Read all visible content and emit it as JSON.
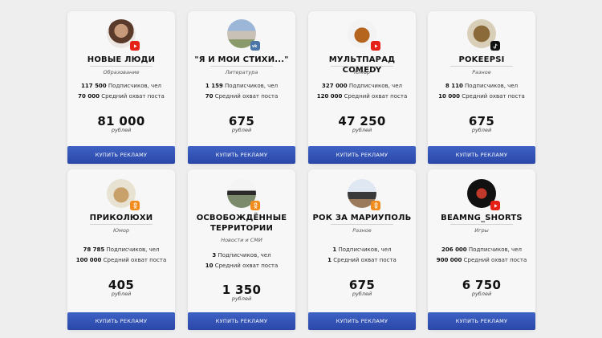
{
  "cards": [
    {
      "title": "НОВЫЕ ЛЮДИ",
      "category": "Образование",
      "subscribers": "117 500",
      "subscribers_label": "Подписчиков, чел",
      "reach": "70 000",
      "reach_label": "Средний охват поста",
      "price": "81 000",
      "price_unit": "рублей",
      "button": "КУПИТЬ РЕКЛАМУ",
      "platform_icon": "youtube-icon"
    },
    {
      "title": "\"Я И МОИ СТИХИ...\"",
      "category": "Литература",
      "subscribers": "1 159",
      "subscribers_label": "Подписчиков, чел",
      "reach": "70",
      "reach_label": "Средний охват поста",
      "price": "675",
      "price_unit": "рублей",
      "button": "КУПИТЬ РЕКЛАМУ",
      "platform_icon": "vk-icon"
    },
    {
      "title": "МУЛЬТПАРАД COMEDY",
      "category": "Юмор",
      "subscribers": "327 000",
      "subscribers_label": "Подписчиков, чел",
      "reach": "120 000",
      "reach_label": "Средний охват поста",
      "price": "47 250",
      "price_unit": "рублей",
      "button": "КУПИТЬ РЕКЛАМУ",
      "platform_icon": "youtube-icon"
    },
    {
      "title": "POKEEPSI",
      "category": "Разное",
      "subscribers": "8 110",
      "subscribers_label": "Подписчиков, чел",
      "reach": "10 000",
      "reach_label": "Средний охват поста",
      "price": "675",
      "price_unit": "рублей",
      "button": "КУПИТЬ РЕКЛАМУ",
      "platform_icon": "tiktok-icon"
    },
    {
      "title": "ПРИКОЛЮХИ",
      "category": "Юмор",
      "subscribers": "78 785",
      "subscribers_label": "Подписчиков, чел",
      "reach": "100 000",
      "reach_label": "Средний охват поста",
      "price": "405",
      "price_unit": "рублей",
      "button": "КУПИТЬ РЕКЛАМУ",
      "platform_icon": "odnoklassniki-icon"
    },
    {
      "title": "ОСВОБОЖДЁННЫЕ ТЕРРИТОРИИ",
      "category": "Новости и СМИ",
      "subscribers": "3",
      "subscribers_label": "Подписчиков, чел",
      "reach": "10",
      "reach_label": "Средний охват поста",
      "price": "1 350",
      "price_unit": "рублей",
      "button": "КУПИТЬ РЕКЛАМУ",
      "platform_icon": "odnoklassniki-icon"
    },
    {
      "title": "РОК ЗА МАРИУПОЛЬ",
      "category": "Разное",
      "subscribers": "1",
      "subscribers_label": "Подписчиков, чел",
      "reach": "1",
      "reach_label": "Средний охват поста",
      "price": "675",
      "price_unit": "рублей",
      "button": "КУПИТЬ РЕКЛАМУ",
      "platform_icon": "odnoklassniki-icon"
    },
    {
      "title": "BEAMNG_SHORTS",
      "category": "Игры",
      "subscribers": "206 000",
      "subscribers_label": "Подписчиков, чел",
      "reach": "900 000",
      "reach_label": "Средний охват поста",
      "price": "6 750",
      "price_unit": "рублей",
      "button": "КУПИТЬ РЕКЛАМУ",
      "platform_icon": "youtube-icon"
    }
  ],
  "colors": {
    "button": "#2f4fb5",
    "youtube": "#e62117",
    "vk": "#4a76a8",
    "tiktok": "#111111",
    "odnoklassniki": "#f28c1c"
  }
}
